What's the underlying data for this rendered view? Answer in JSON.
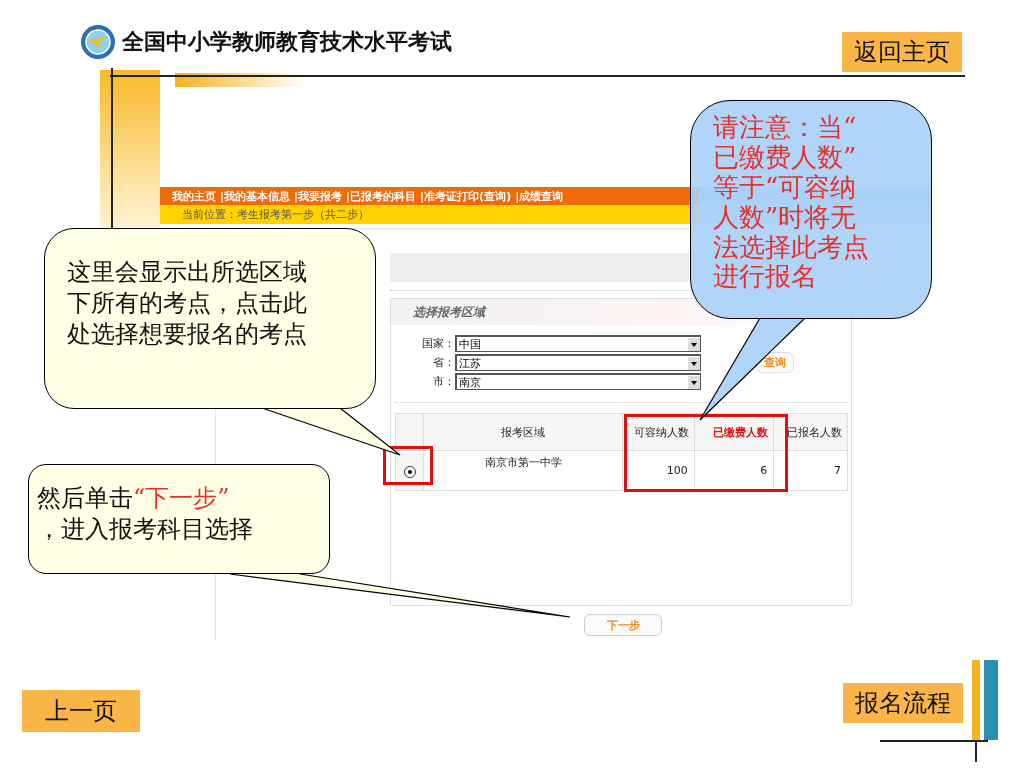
{
  "header": {
    "title": "全国中小学教师教育技术水平考试",
    "home_button": "返回主页"
  },
  "site": {
    "nav": [
      "我的主页",
      "|我的基本信息",
      "|我要报考",
      "|已报考的科目",
      "|准考证打印(查询)",
      "|成绩查询"
    ],
    "breadcrumb": "当前位置：考生报考第一步（共二步）"
  },
  "region": {
    "title": "选择报考区域",
    "fields": [
      {
        "label": "国家：",
        "value": "中国"
      },
      {
        "label": "省：",
        "value": "江苏"
      },
      {
        "label": "市：",
        "value": "南京"
      }
    ],
    "query_button": "查询"
  },
  "table": {
    "columns": [
      {
        "label": "报考区域",
        "emphasis": false
      },
      {
        "label": "可容纳人数",
        "emphasis": false
      },
      {
        "label": "已缴费人数",
        "emphasis": true
      },
      {
        "label": "已报名人数",
        "emphasis": false
      }
    ],
    "rows": [
      {
        "selected": true,
        "cells": [
          "南京市第一中学",
          "100",
          "6",
          "7"
        ]
      }
    ]
  },
  "next_button": "下一步",
  "callout_region": {
    "text": "这里会显示出所选区域下所有的考点，点击此处选择想要报名的考点"
  },
  "callout_next": {
    "text_before": "然后单击",
    "highlight": "“下一步”",
    "text_after": "，进入报考科目选择"
  },
  "callout_warning": {
    "text": "请注意：当“已缴费人数”等于“可容纳人数”时将无法选择此考点进行报名"
  },
  "footer": {
    "prev_button": "上一页",
    "flow_button": "报名流程"
  }
}
